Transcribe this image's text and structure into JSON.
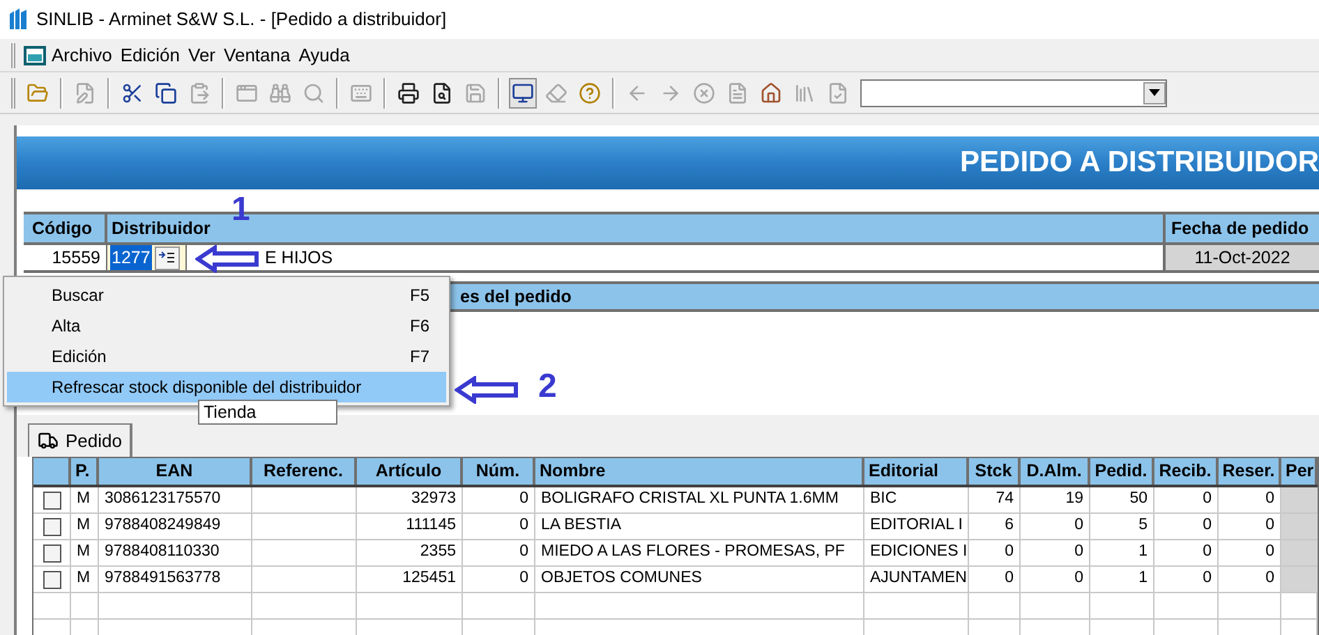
{
  "window": {
    "title": "SINLIB - Arminet S&W S.L. - [Pedido a distribuidor]"
  },
  "menu": [
    "Archivo",
    "Edición",
    "Ver",
    "Ventana",
    "Ayuda"
  ],
  "toolbar": [
    {
      "kind": "open",
      "disabled": false
    },
    {
      "kind": "sep"
    },
    {
      "kind": "edit",
      "disabled": true
    },
    {
      "kind": "sep"
    },
    {
      "kind": "cut",
      "disabled": false
    },
    {
      "kind": "copy",
      "disabled": false
    },
    {
      "kind": "paste",
      "disabled": true
    },
    {
      "kind": "sep"
    },
    {
      "kind": "window",
      "disabled": true
    },
    {
      "kind": "binoculars",
      "disabled": true
    },
    {
      "kind": "search",
      "disabled": true
    },
    {
      "kind": "sep"
    },
    {
      "kind": "keyboard",
      "disabled": true
    },
    {
      "kind": "sep"
    },
    {
      "kind": "print",
      "disabled": false
    },
    {
      "kind": "preview",
      "disabled": false
    },
    {
      "kind": "save",
      "disabled": true
    },
    {
      "kind": "sep"
    },
    {
      "kind": "screen",
      "disabled": false
    },
    {
      "kind": "eraser",
      "disabled": true
    },
    {
      "kind": "help",
      "disabled": false
    },
    {
      "kind": "sep"
    },
    {
      "kind": "back",
      "disabled": true
    },
    {
      "kind": "forward",
      "disabled": true
    },
    {
      "kind": "cancel",
      "disabled": true
    },
    {
      "kind": "doc",
      "disabled": true
    },
    {
      "kind": "home",
      "disabled": false
    },
    {
      "kind": "books",
      "disabled": true
    },
    {
      "kind": "check",
      "disabled": true
    }
  ],
  "banner": "PEDIDO A DISTRIBUIDOR",
  "header": {
    "codigo_label": "Código",
    "distribuidor_label": "Distribuidor",
    "fecha_label": "Fecha de pedido",
    "codigo": "15559",
    "distribuidor_code": "1277",
    "distribuidor_name": "E HIJOS",
    "fecha": "11-Oct-2022"
  },
  "section_title": "es del pedido",
  "dropdown": {
    "value": "Tienda"
  },
  "context_menu": [
    {
      "label": "Buscar",
      "shortcut": "F5",
      "selected": false
    },
    {
      "label": "Alta",
      "shortcut": "F6",
      "selected": false
    },
    {
      "label": "Edición",
      "shortcut": "F7",
      "selected": false
    },
    {
      "label": "Refrescar stock disponible del distribuidor",
      "selected": true
    }
  ],
  "annotations": [
    "1",
    "2"
  ],
  "tabs": [
    {
      "label": "Pedido",
      "selected": true
    }
  ],
  "table": {
    "columns": [
      "P.",
      "EAN",
      "Referenc.",
      "Artículo",
      "Núm.",
      "Nombre",
      "Editorial",
      "Stck",
      "D.Alm.",
      "Pedid.",
      "Recib.",
      "Reser.",
      "Per"
    ],
    "rows": [
      {
        "checked": false,
        "cells": [
          "M",
          "3086123175570",
          "",
          "32973",
          "0",
          "BOLIGRAFO CRISTAL XL PUNTA 1.6MM",
          "BIC",
          "74",
          "19",
          "50",
          "0",
          "0"
        ]
      },
      {
        "checked": false,
        "cells": [
          "M",
          "9788408249849",
          "",
          "111145",
          "0",
          "LA BESTIA",
          "EDITORIAL I",
          "6",
          "0",
          "5",
          "0",
          "0"
        ]
      },
      {
        "checked": false,
        "cells": [
          "M",
          "9788408110330",
          "",
          "2355",
          "0",
          "MIEDO A LAS FLORES - PROMESAS, PF",
          "EDICIONES I",
          "0",
          "0",
          "1",
          "0",
          "0"
        ]
      },
      {
        "checked": false,
        "cells": [
          "M",
          "9788491563778",
          "",
          "125451",
          "0",
          "OBJETOS COMUNES",
          "AJUNTAMEN",
          "0",
          "0",
          "1",
          "0",
          "0"
        ]
      }
    ]
  }
}
